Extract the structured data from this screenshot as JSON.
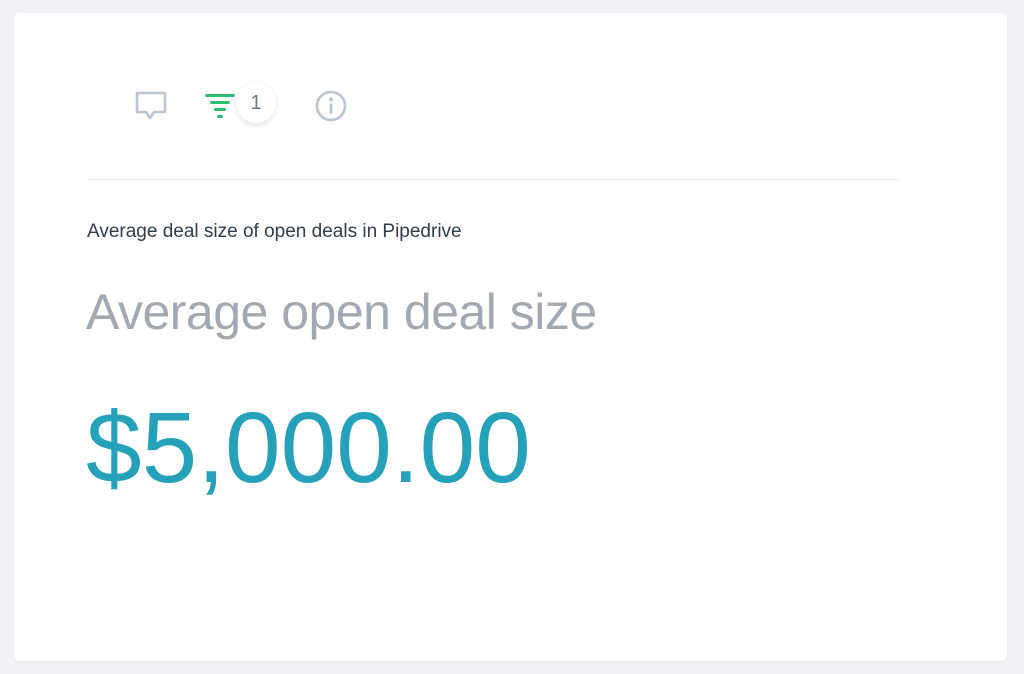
{
  "toolbar": {
    "icons": {
      "comment": "comment-icon",
      "filter": "filter-icon",
      "info": "info-icon"
    },
    "filter_count": "1"
  },
  "widget": {
    "subtitle": "Average deal size of open deals in Pipedrive",
    "title": "Average open deal size",
    "value": "$5,000.00"
  },
  "colors": {
    "accent_value": "#25a1b9",
    "filter_active": "#2fbf71",
    "icon_muted": "#b8c6d4",
    "title_text": "#a3a9b2",
    "subtitle_text": "#2f3d4c"
  }
}
